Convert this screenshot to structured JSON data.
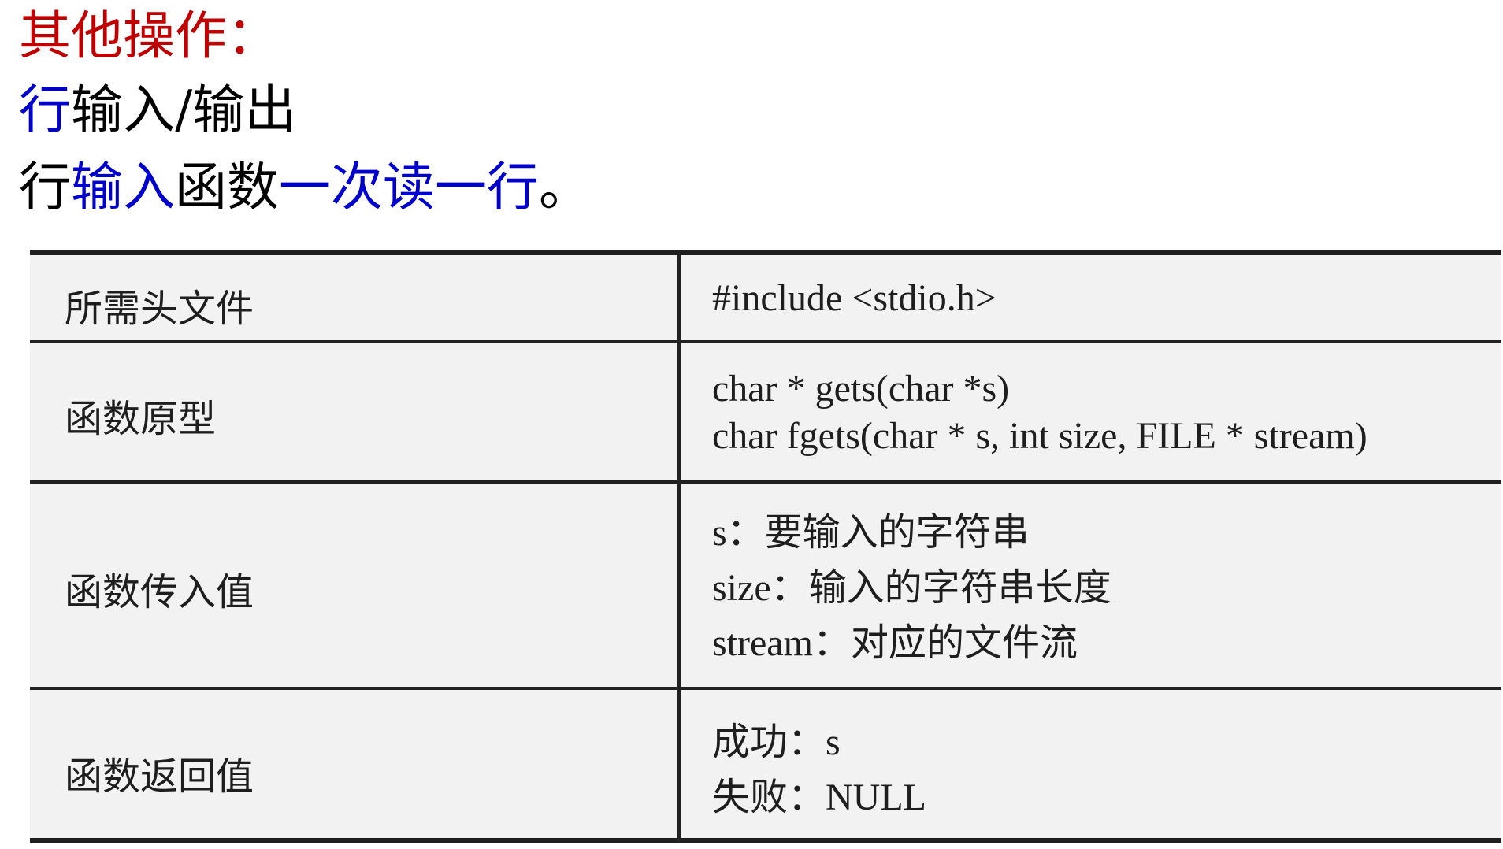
{
  "headings": {
    "line1": "其他操作：",
    "line2_part1": "行",
    "line2_part2": "输入/输出",
    "line3_part1": "行",
    "line3_part2": "输入",
    "line3_part3": "函数",
    "line3_part4": "一次读一行",
    "line3_part5": "。"
  },
  "table": {
    "rows": [
      {
        "label": "所需头文件",
        "values": [
          "#include <stdio.h>"
        ]
      },
      {
        "label": "函数原型",
        "values": [
          "char * gets(char *s)",
          "char fgets(char * s, int size, FILE * stream)"
        ]
      },
      {
        "label": "函数传入值",
        "values": [
          "s：要输入的字符串",
          "size：输入的字符串长度",
          "stream：对应的文件流"
        ]
      },
      {
        "label": "函数返回值",
        "values": [
          "成功：s",
          "失败：NULL"
        ]
      }
    ]
  },
  "colors": {
    "red": "#c00000",
    "blue": "#0000cc",
    "text": "#1e1e1e",
    "table_bg": "#f2f2f2"
  }
}
